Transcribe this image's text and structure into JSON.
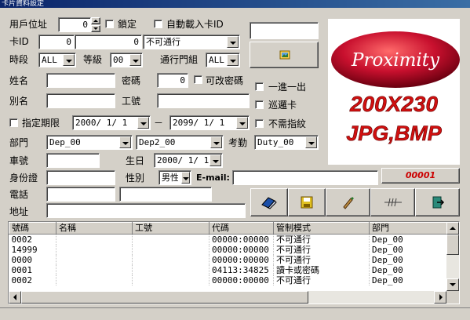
{
  "window": {
    "title": "卡片資料設定"
  },
  "form": {
    "user_address_label": "用戶位址",
    "user_address_value": "0",
    "lock_label": "鎖定",
    "auto_load_label": "自動載入卡ID",
    "card_id_label": "卡ID",
    "card_id_1": "0",
    "card_id_2": "0",
    "access_value": "不可通行",
    "period_label": "時段",
    "period_value": "ALL",
    "level_label": "等級",
    "level_value": "00",
    "door_group_label": "通行門組",
    "door_group_value": "ALL",
    "name_label": "姓名",
    "password_label": "密碼",
    "password_value": "0",
    "changeable_pw_label": "可改密碼",
    "alias_label": "別名",
    "employee_no_label": "工號",
    "one_in_one_out_label": "一進一出",
    "patrol_card_label": "巡邏卡",
    "no_fingerprint_label": "不需指紋",
    "expiry_label": "指定期限",
    "date_from": "2000/ 1/ 1",
    "date_sep": "－",
    "date_to": "2099/ 1/ 1",
    "department_label": "部門",
    "dept1_value": "Dep_00",
    "dept2_value": "Dep2_00",
    "attendance_label": "考勤",
    "attendance_value": "Duty_00",
    "plate_label": "車號",
    "birthday_label": "生日",
    "birthday_value": "2000/ 1/ 1",
    "id_label": "身份證",
    "gender_label": "性別",
    "gender_value": "男性",
    "email_label": "E-mail:",
    "record_no": "00001",
    "phone_label": "電話",
    "address_label": "地址"
  },
  "photo": {
    "brand": "Proximity",
    "size": "200X230",
    "formats": "JPG,BMP"
  },
  "toolbar": {
    "icons": [
      "eraser-icon",
      "save-icon",
      "pen-icon",
      "wave-icon",
      "exit-icon"
    ]
  },
  "table": {
    "columns": [
      "號碼",
      "名稱",
      "工號",
      "代碼",
      "管制模式",
      "部門"
    ],
    "rows": [
      [
        "0002",
        "",
        "",
        "00000:00000",
        "不可通行",
        "Dep_00"
      ],
      [
        "14999",
        "",
        "",
        "00000:00000",
        "不可通行",
        "Dep_00"
      ],
      [
        "0000",
        "",
        "",
        "00000:00000",
        "不可通行",
        "Dep_00"
      ],
      [
        "0001",
        "",
        "",
        "04113:34825",
        "讀卡或密碼",
        "Dep_00"
      ],
      [
        "0002",
        "",
        "",
        "00000:00000",
        "不可通行",
        "Dep_00"
      ]
    ]
  },
  "colors": {
    "record_no": "#cc0000",
    "title_bar": "#0a246a",
    "logo_red": "#c8102e"
  }
}
